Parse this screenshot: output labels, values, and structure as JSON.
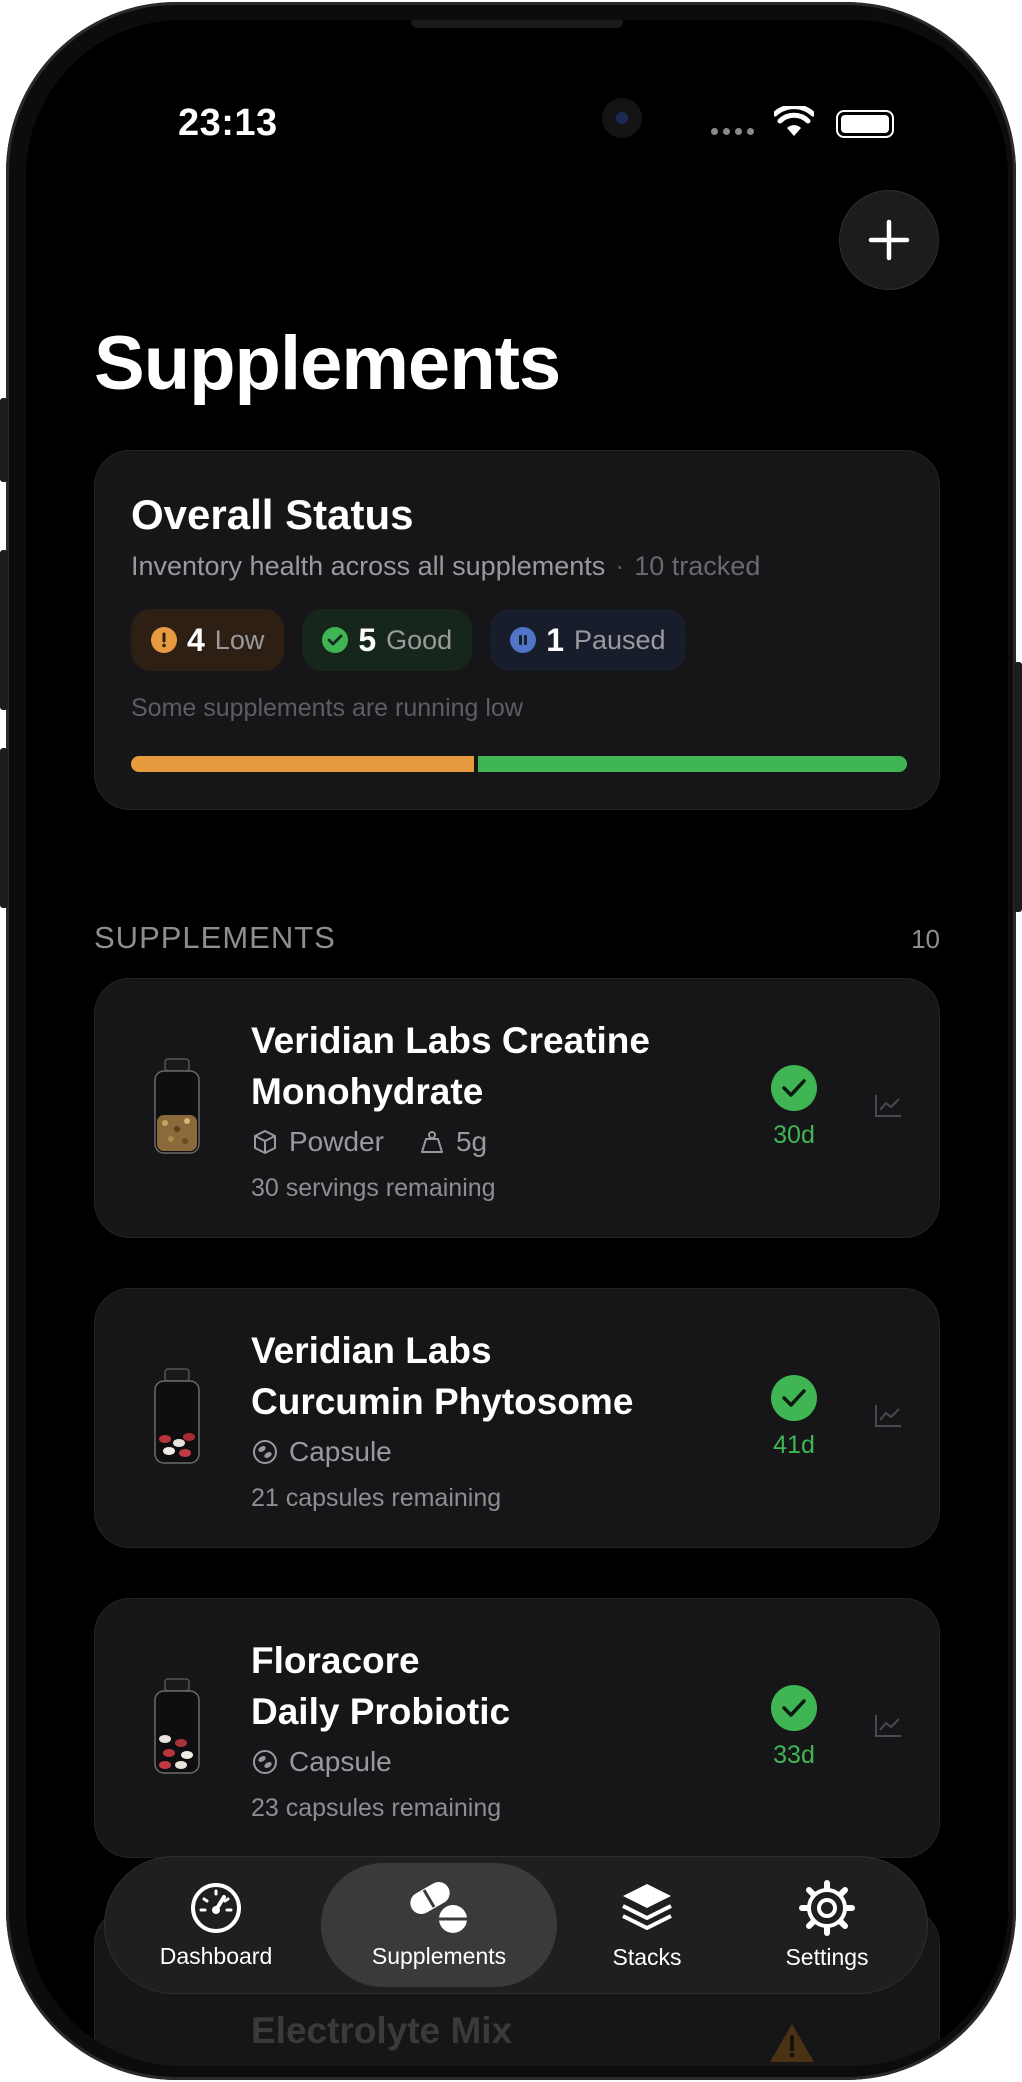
{
  "status_bar": {
    "time": "23:13"
  },
  "page": {
    "title": "Supplements"
  },
  "overall_status": {
    "title": "Overall Status",
    "subtitle": "Inventory health across all supplements",
    "tracked": "10 tracked",
    "pills": [
      {
        "count": "4",
        "label": "Low",
        "color": "#e79a3e"
      },
      {
        "count": "5",
        "label": "Good",
        "color": "#3fb653"
      },
      {
        "count": "1",
        "label": "Paused",
        "color": "#4f74c8"
      }
    ],
    "message": "Some supplements are running low",
    "bar": {
      "low_fraction": 0.444,
      "good_fraction": 0.556
    }
  },
  "section": {
    "title": "SUPPLEMENTS",
    "count": "10"
  },
  "supplements": [
    {
      "name_line1": "Veridian Labs Creatine",
      "name_line2": "Monohydrate",
      "form": "Powder",
      "dose": "5g",
      "remaining": "30 servings remaining",
      "days": "30d",
      "status": "good"
    },
    {
      "name_line1": "Veridian Labs",
      "name_line2": "Curcumin Phytosome",
      "form": "Capsule",
      "remaining": "21 capsules remaining",
      "days": "41d",
      "status": "good"
    },
    {
      "name_line1": "Floracore",
      "name_line2": "Daily Probiotic",
      "form": "Capsule",
      "remaining": "23 capsules remaining",
      "days": "33d",
      "status": "good"
    },
    {
      "name_line1": "Electrolyte Mix",
      "status": "low"
    }
  ],
  "tabs": [
    {
      "label": "Dashboard",
      "icon": "gauge-icon"
    },
    {
      "label": "Supplements",
      "icon": "pills-icon",
      "active": true
    },
    {
      "label": "Stacks",
      "icon": "layers-icon"
    },
    {
      "label": "Settings",
      "icon": "gear-icon"
    }
  ],
  "colors": {
    "accent_good": "#3fb653",
    "accent_low": "#e79a3e",
    "accent_paused": "#4f74c8"
  }
}
